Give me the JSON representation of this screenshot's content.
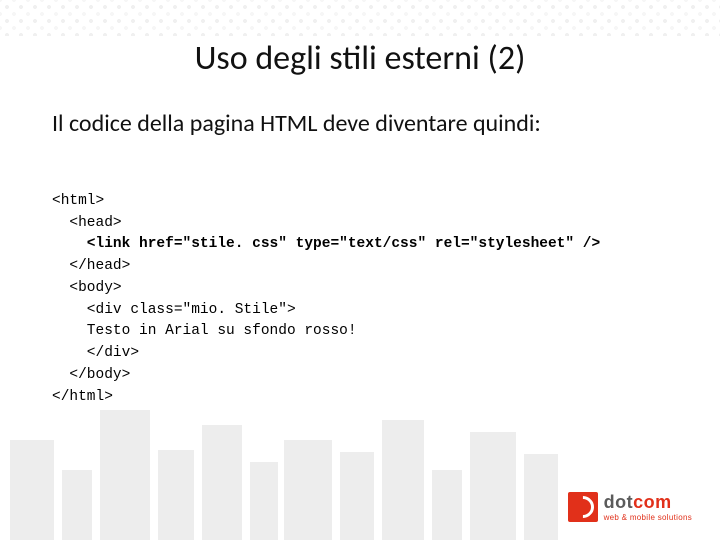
{
  "title": "Uso degli stili esterni (2)",
  "subtitle": "Il codice della pagina HTML deve diventare quindi:",
  "code": {
    "l1": "<html>",
    "l2": "  <head>",
    "l3": "    <link href=\"stile. css\" type=\"text/css\" rel=\"stylesheet\" />",
    "l4": "  </head>",
    "l5": "  <body>",
    "l6": "    <div class=\"mio. Stile\">",
    "l7": "    Testo in Arial su sfondo rosso!",
    "l8": "    </div>",
    "l9": "  </body>",
    "l10": "</html>"
  },
  "logo": {
    "brand_left": "dot",
    "brand_right": "com",
    "tagline": "web & mobile solutions"
  }
}
